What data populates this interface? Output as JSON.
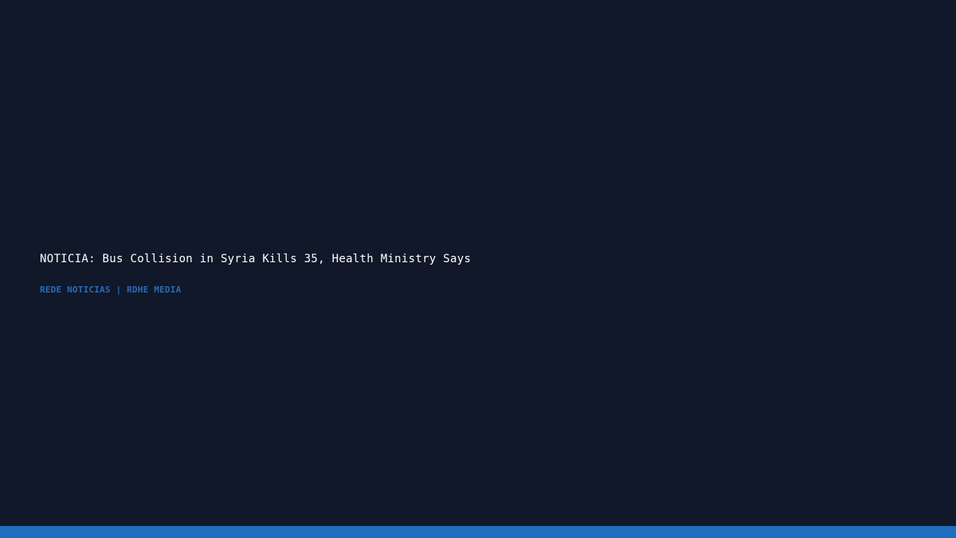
{
  "headline": "NOTICIA: Bus Collision in Syria Kills 35, Health Ministry Says",
  "byline": "REDE NOTICIAS | RDHE MEDIA",
  "colors": {
    "background": "#10182a",
    "headline": "#ffffff",
    "byline": "#2a6bb5",
    "accent_bar": "#1f6ebd"
  }
}
